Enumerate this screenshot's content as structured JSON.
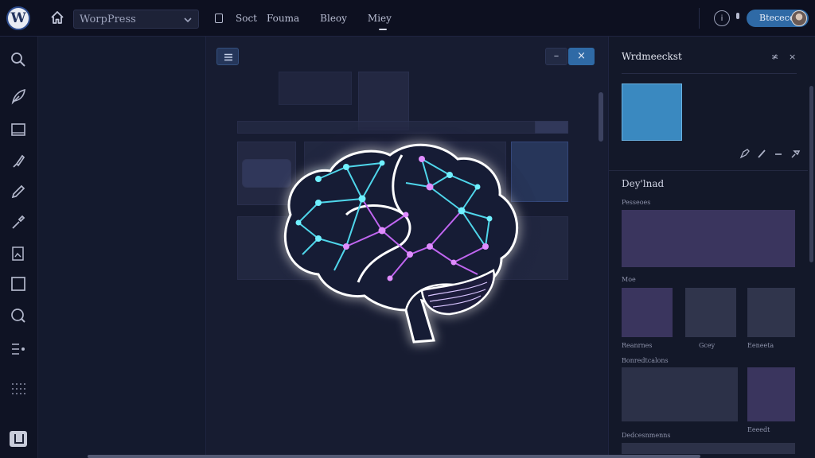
{
  "topbar": {
    "logo_letter": "W",
    "site_select": "WorpPress",
    "nav": [
      "Soct",
      "Fouma",
      "Bleoy",
      "Miey"
    ],
    "help": "i",
    "profile_button": "Btecece"
  },
  "canvas": {
    "list_button": "≡",
    "min_button": "–",
    "close_button": "×"
  },
  "panel": {
    "title": "Wrdmeeckst",
    "controls": [
      "≭",
      "×"
    ],
    "section_title": "Dey'lnad",
    "label_1": "Pesseoes",
    "label_2": "Moe",
    "row_labels": [
      "Reanrnes",
      "Gcey",
      "Eeneeta"
    ],
    "label_3": "Bonredtcalons",
    "label_4": "Eeeedt",
    "label_5": "Dedcesnmenns",
    "swatch_color": "#3a89c0"
  },
  "colors": {
    "accent": "#2f6aa6",
    "brain_cyan": "#4fd6ea",
    "brain_purple": "#c066f0"
  }
}
